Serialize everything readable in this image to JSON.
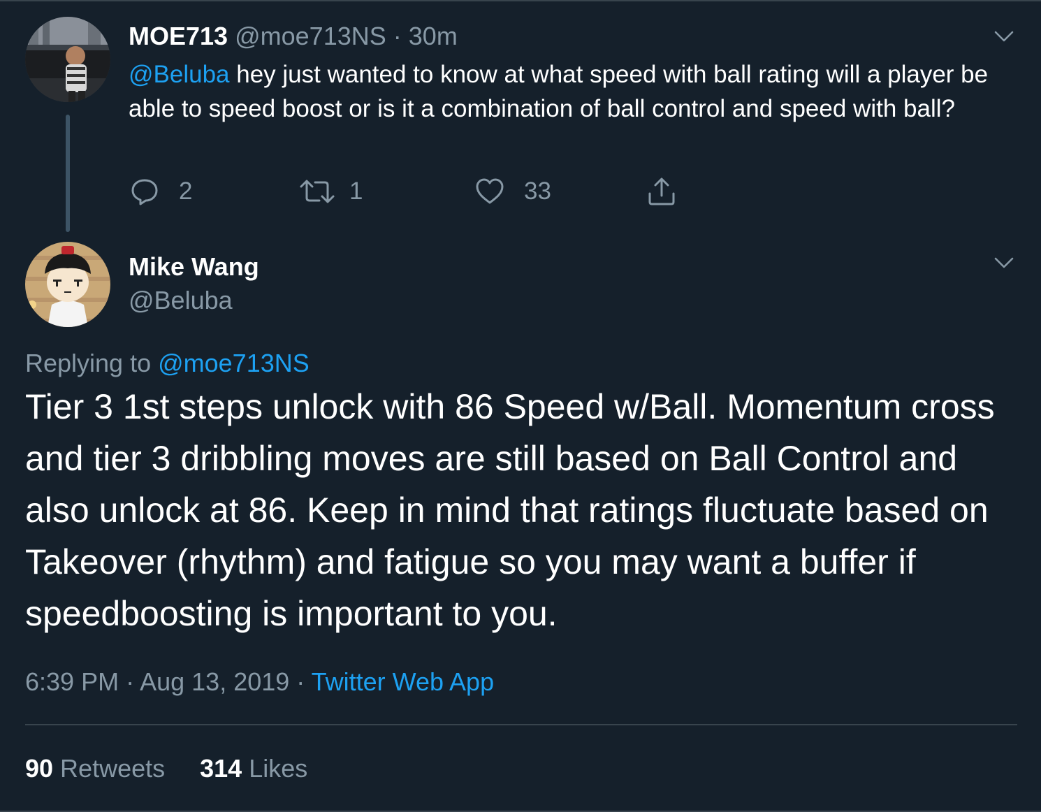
{
  "parent_tweet": {
    "display_name": "MOE713",
    "handle": "@moe713NS",
    "separator": "·",
    "time": "30m",
    "mention": "@Beluba",
    "text": " hey just wanted to know at what speed with ball rating will a player be able to speed boost or is it a combination of ball control and speed with ball?",
    "actions": {
      "reply_count": "2",
      "retweet_count": "1",
      "like_count": "33"
    },
    "icons": [
      "reply-icon",
      "retweet-icon",
      "like-icon",
      "share-icon",
      "chevron-down-icon"
    ]
  },
  "reply_tweet": {
    "display_name": "Mike Wang",
    "handle": "@Beluba",
    "replying_label": "Replying to ",
    "replying_to": "@moe713NS",
    "text": "Tier 3 1st steps unlock with 86 Speed w/Ball. Momentum cross and tier 3 dribbling moves are still based on Ball Control and also unlock at 86. Keep in mind that ratings fluctuate based on Takeover (rhythm) and fatigue so you may want a buffer if speedboosting is important to you.",
    "time": "6:39 PM",
    "separator": " · ",
    "date": "Aug 13, 2019",
    "source": "Twitter Web App",
    "stats": {
      "retweets_count": "90",
      "retweets_label": " Retweets",
      "likes_count": "314",
      "likes_label": " Likes"
    }
  },
  "colors": {
    "background": "#15202b",
    "link": "#1da1f2",
    "muted": "#8899a6",
    "border": "#38444d",
    "thread_line": "#3d5466"
  }
}
